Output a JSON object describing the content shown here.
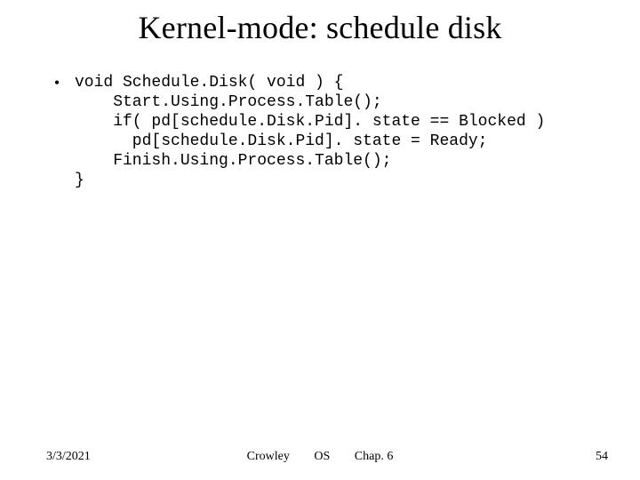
{
  "title": "Kernel-mode: schedule disk",
  "bullet_marker": "•",
  "code": "void Schedule.Disk( void ) {\n    Start.Using.Process.Table();\n    if( pd[schedule.Disk.Pid]. state == Blocked )\n      pd[schedule.Disk.Pid]. state = Ready;\n    Finish.Using.Process.Table();\n}",
  "footer": {
    "date": "3/3/2021",
    "author": "Crowley",
    "course": "OS",
    "chapter": "Chap. 6",
    "page": "54"
  }
}
